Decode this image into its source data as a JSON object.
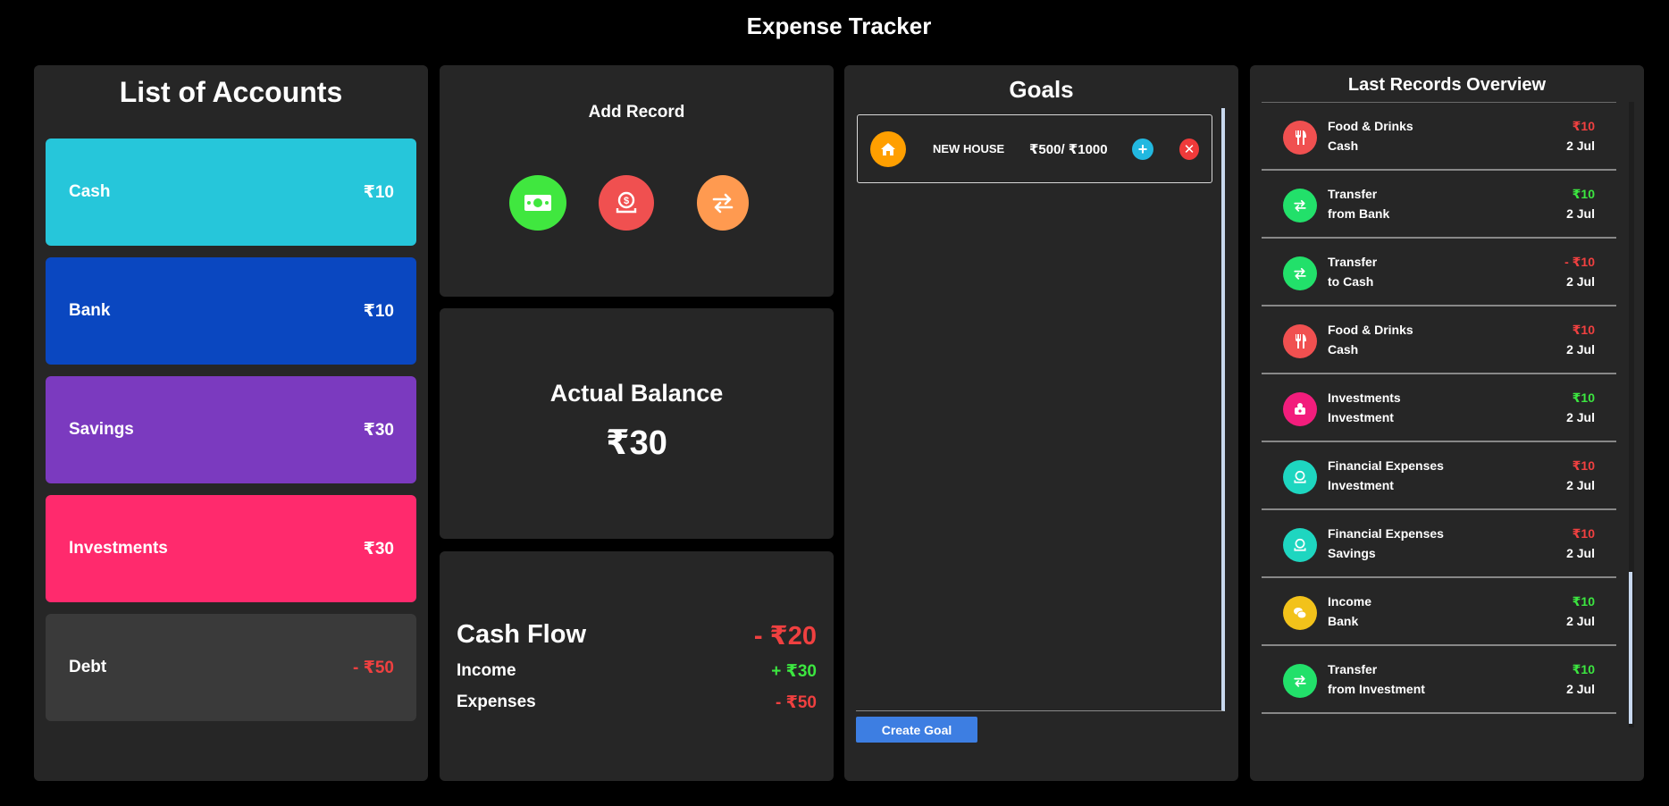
{
  "app": {
    "title": "Expense Tracker"
  },
  "accounts": {
    "title": "List of Accounts",
    "items": [
      {
        "name": "Cash",
        "amount": "₹10",
        "color": "#26c6da"
      },
      {
        "name": "Bank",
        "amount": "₹10",
        "color": "#0a47c0"
      },
      {
        "name": "Savings",
        "amount": "₹30",
        "color": "#7b3abf"
      },
      {
        "name": "Investments",
        "amount": "₹30",
        "color": "#ff2a6d"
      },
      {
        "name": "Debt",
        "amount": "- ₹50",
        "color": "#3a3a3a"
      }
    ]
  },
  "add_record": {
    "title": "Add Record",
    "buttons": [
      {
        "icon": "cash-icon",
        "color": "#40e73f"
      },
      {
        "icon": "money-bag-icon",
        "color": "#f05050"
      },
      {
        "icon": "transfer-icon",
        "color": "#ff9a50"
      }
    ]
  },
  "balance": {
    "label": "Actual Balance",
    "amount": "₹30"
  },
  "cash_flow": {
    "title": "Cash Flow",
    "total": "- ₹20",
    "income_label": "Income",
    "income": "+ ₹30",
    "expenses_label": "Expenses",
    "expenses": "- ₹50"
  },
  "goals": {
    "title": "Goals",
    "items": [
      {
        "icon": "home-icon",
        "name": "NEW HOUSE",
        "progress": "₹500/ ₹1000",
        "progress_fraction": 0.5
      }
    ],
    "create_label": "Create Goal"
  },
  "records": {
    "title": "Last Records Overview",
    "items": [
      {
        "category": "Food & Drinks",
        "account": "Cash",
        "amount": "₹10",
        "date": "2 Jul",
        "type": "expense",
        "icon": "fork-knife-icon",
        "color": "#f05050"
      },
      {
        "category": "Transfer",
        "account": "from Bank",
        "amount": "₹10",
        "date": "2 Jul",
        "type": "income",
        "icon": "transfer-icon",
        "color": "#22e06a"
      },
      {
        "category": "Transfer",
        "account": "to Cash",
        "amount": "- ₹10",
        "date": "2 Jul",
        "type": "expense",
        "icon": "transfer-icon",
        "color": "#22e06a"
      },
      {
        "category": "Food & Drinks",
        "account": "Cash",
        "amount": "₹10",
        "date": "2 Jul",
        "type": "expense",
        "icon": "fork-knife-icon",
        "color": "#f05050"
      },
      {
        "category": "Investments",
        "account": "Investment",
        "amount": "₹10",
        "date": "2 Jul",
        "type": "income",
        "icon": "piggy-bank-icon",
        "color": "#f21d7c"
      },
      {
        "category": "Financial Expenses",
        "account": "Investment",
        "amount": "₹10",
        "date": "2 Jul",
        "type": "expense",
        "icon": "money-bag-icon",
        "color": "#1ed6c0"
      },
      {
        "category": "Financial Expenses",
        "account": "Savings",
        "amount": "₹10",
        "date": "2 Jul",
        "type": "expense",
        "icon": "money-bag-icon",
        "color": "#1ed6c0"
      },
      {
        "category": "Income",
        "account": "Bank",
        "amount": "₹10",
        "date": "2 Jul",
        "type": "income",
        "icon": "coins-icon",
        "color": "#f2c21a"
      },
      {
        "category": "Transfer",
        "account": "from Investment",
        "amount": "₹10",
        "date": "2 Jul",
        "type": "income",
        "icon": "transfer-icon",
        "color": "#22e06a"
      }
    ]
  }
}
